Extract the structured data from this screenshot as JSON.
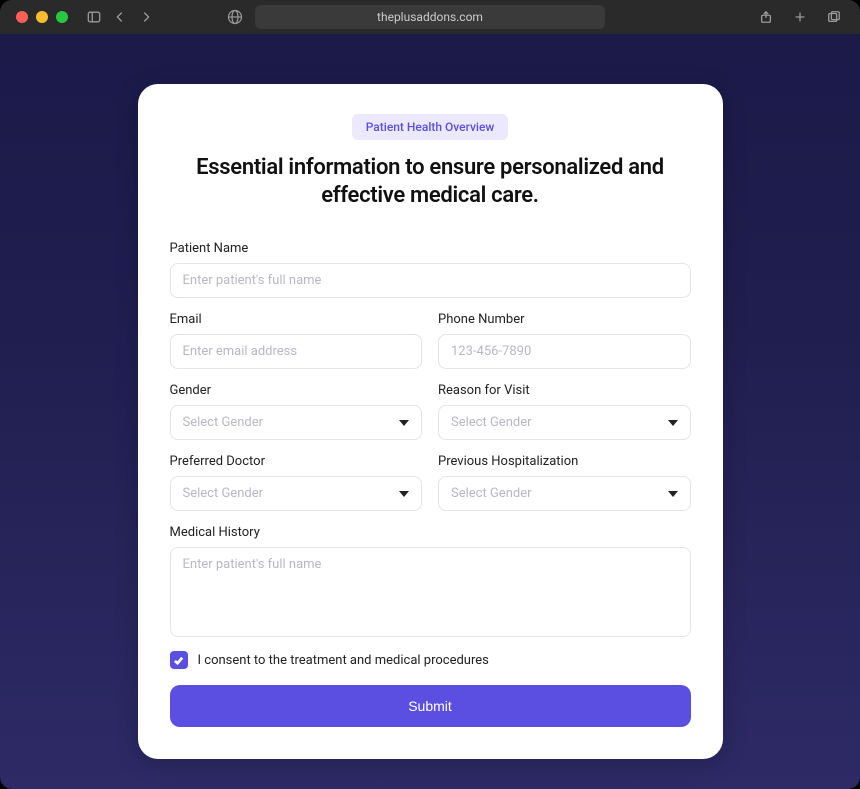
{
  "browser": {
    "url": "theplusaddons.com"
  },
  "card": {
    "badge": "Patient Health Overview",
    "headline": "Essential information to ensure personalized and effective medical care."
  },
  "fields": {
    "patient_name": {
      "label": "Patient Name",
      "placeholder": "Enter patient's full name"
    },
    "email": {
      "label": "Email",
      "placeholder": "Enter email address"
    },
    "phone": {
      "label": "Phone Number",
      "placeholder": "123-456-7890"
    },
    "gender": {
      "label": "Gender",
      "selected": "Select Gender"
    },
    "reason": {
      "label": "Reason for Visit",
      "selected": "Select Gender"
    },
    "doctor": {
      "label": "Preferred Doctor",
      "selected": "Select Gender"
    },
    "hospitalization": {
      "label": "Previous Hospitalization",
      "selected": "Select Gender"
    },
    "history": {
      "label": "Medical History",
      "placeholder": "Enter patient's full name"
    }
  },
  "consent": {
    "checked": true,
    "label": "I consent to the treatment and medical procedures"
  },
  "submit": {
    "label": "Submit"
  },
  "colors": {
    "accent": "#5a4fe0",
    "badge_bg": "#ece9ff"
  }
}
